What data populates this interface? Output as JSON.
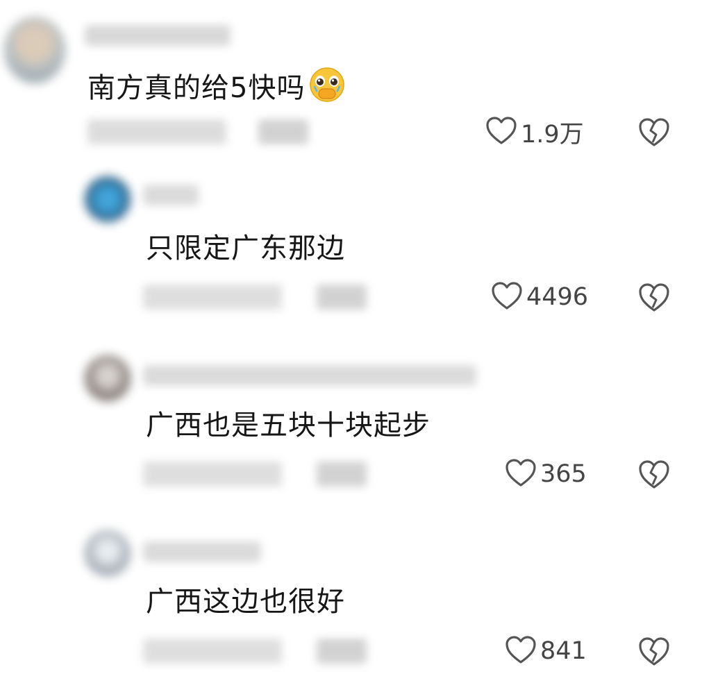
{
  "comments": [
    {
      "text": "南方真的给5快吗",
      "emoji": "pleading-face-covering-mouth",
      "likes": "1.9万",
      "avatar_color": "#9ea8ad",
      "icons": {
        "like": "heart-outline-icon",
        "dislike": "broken-heart-icon"
      }
    },
    {
      "text": "只限定广东那边",
      "likes": "4496",
      "avatar_color": "#1f5f8a",
      "icons": {
        "like": "heart-outline-icon",
        "dislike": "broken-heart-icon"
      }
    },
    {
      "text": "广西也是五块十块起步",
      "likes": "365",
      "avatar_color": "#6f6764",
      "icons": {
        "like": "heart-outline-icon",
        "dislike": "broken-heart-icon"
      }
    },
    {
      "text": "广西这边也很好",
      "likes": "841",
      "avatar_color": "#8f98a3",
      "icons": {
        "like": "heart-outline-icon",
        "dislike": "broken-heart-icon"
      }
    }
  ],
  "colors": {
    "text": "#161616",
    "secondary": "#444444",
    "blur": "#bdbdbd"
  }
}
